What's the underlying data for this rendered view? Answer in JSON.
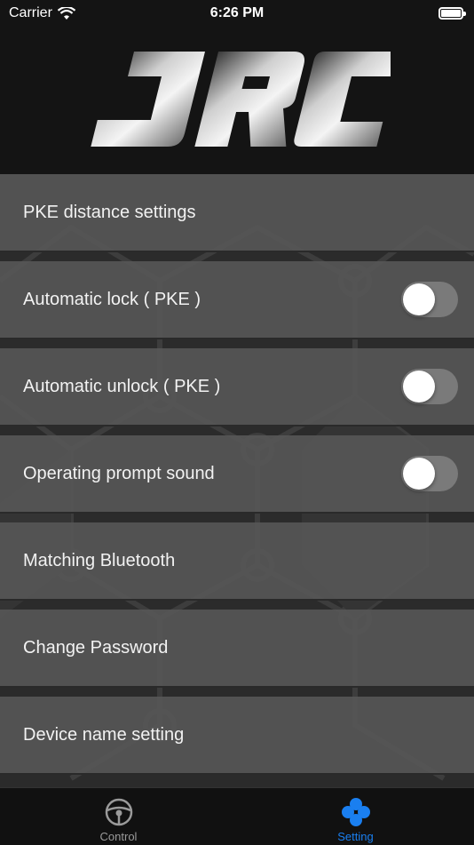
{
  "status_bar": {
    "carrier": "Carrier",
    "time": "6:26 PM"
  },
  "header": {
    "logo_text": "JRC"
  },
  "settings": [
    {
      "label": "PKE distance settings",
      "has_toggle": false
    },
    {
      "label": "Automatic lock ( PKE )",
      "has_toggle": true,
      "on": false
    },
    {
      "label": "Automatic unlock ( PKE )",
      "has_toggle": true,
      "on": false
    },
    {
      "label": "Operating prompt sound",
      "has_toggle": true,
      "on": false
    },
    {
      "label": "Matching Bluetooth",
      "has_toggle": false
    },
    {
      "label": "Change Password",
      "has_toggle": false
    },
    {
      "label": "Device name setting",
      "has_toggle": false
    }
  ],
  "tabs": {
    "control": "Control",
    "setting": "Setting"
  },
  "colors": {
    "accent": "#1a7ff0",
    "row_bg": "#565656",
    "toggle_off": "#7a7a7a"
  },
  "icons": {
    "control": "steering-wheel-icon",
    "setting": "four-dots-icon"
  }
}
